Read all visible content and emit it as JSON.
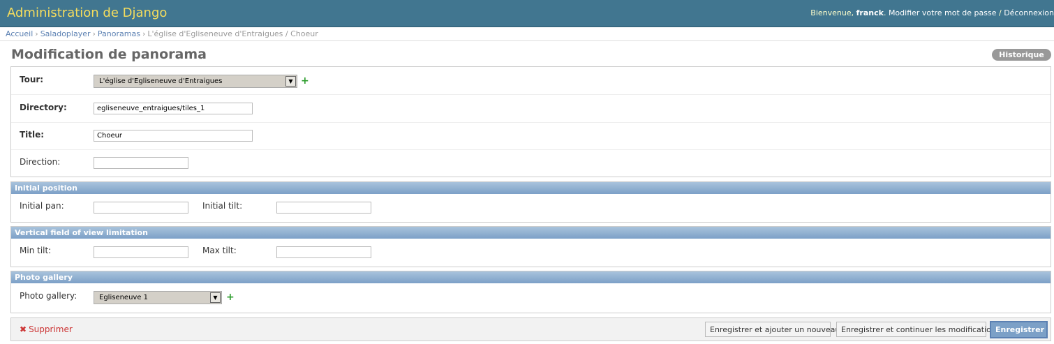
{
  "header": {
    "site_name": "Administration de Django",
    "welcome": "Bienvenue,",
    "username": "franck",
    "change_password": "Modifier votre mot de passe",
    "separator": "/",
    "logout": "Déconnexion"
  },
  "breadcrumbs": {
    "home": "Accueil",
    "app": "Saladoplayer",
    "model": "Panoramas",
    "current": "L'église d'Egliseneuve d'Entraigues / Choeur",
    "sep": "›"
  },
  "page": {
    "title": "Modification de panorama",
    "history_button": "Historique"
  },
  "fieldsets": {
    "main": {
      "tour_label": "Tour:",
      "tour_value": "L'église d'Egliseneuve d'Entraigues",
      "directory_label": "Directory:",
      "directory_value": "egliseneuve_entraigues/tiles_1",
      "title_label": "Title:",
      "title_value": "Choeur",
      "direction_label": "Direction:",
      "direction_value": ""
    },
    "initial_position": {
      "legend": "Initial position",
      "pan_label": "Initial pan:",
      "tilt_label": "Initial tilt:"
    },
    "vertical_fov": {
      "legend": "Vertical field of view limitation",
      "min_label": "Min tilt:",
      "max_label": "Max tilt:"
    },
    "photo_gallery": {
      "legend": "Photo gallery",
      "label": "Photo gallery:",
      "value": "Egliseneuve 1"
    }
  },
  "submit": {
    "delete": "Supprimer",
    "save_add": "Enregistrer et ajouter un nouveau",
    "save_continue": "Enregistrer et continuer les modifications",
    "save": "Enregistrer"
  },
  "icons": {
    "add": "plus-icon",
    "delete": "x-icon",
    "dropdown": "chevron-down-icon"
  },
  "colors": {
    "header_bg": "#417690",
    "site_name": "#f5dd5d",
    "legend_bg": "#7ca0c7",
    "delete": "#cc3434",
    "add_icon": "#2e9d2e"
  }
}
